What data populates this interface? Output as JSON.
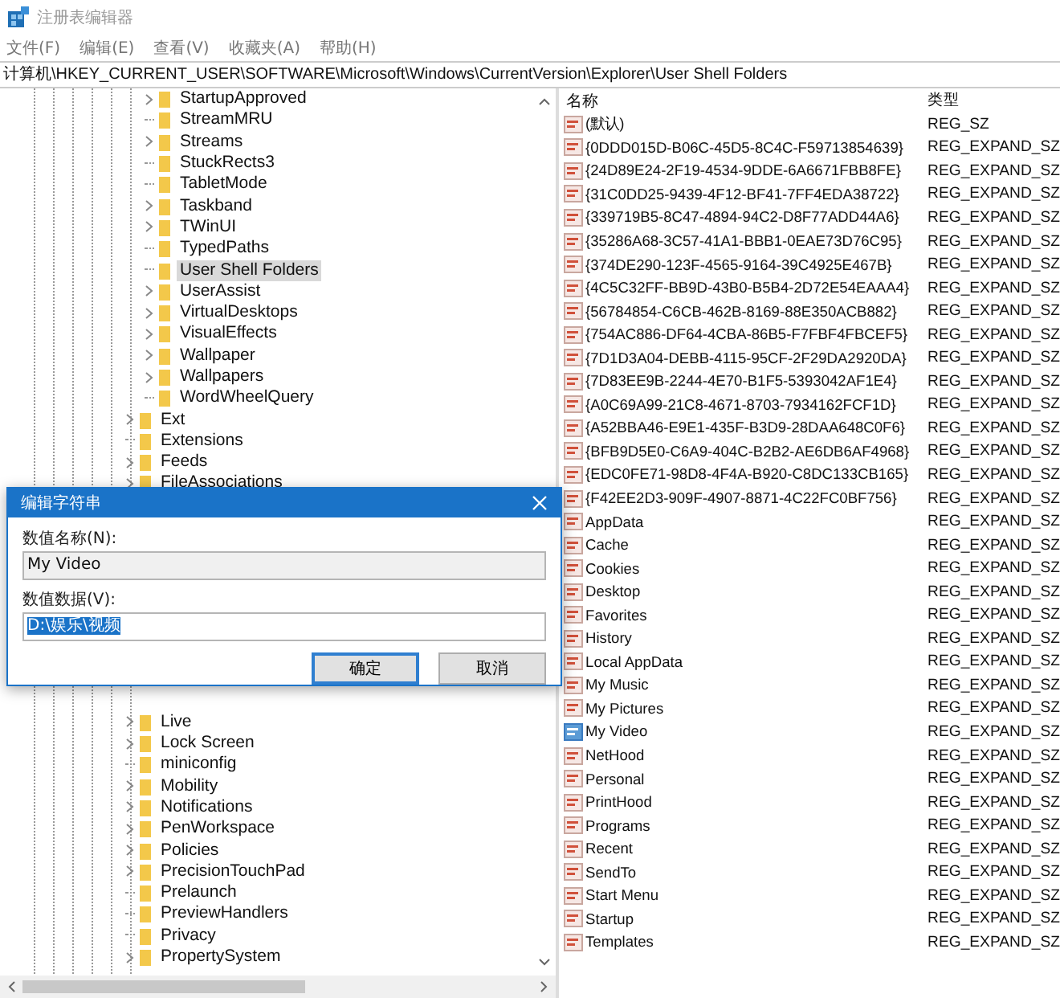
{
  "window": {
    "title": "注册表编辑器"
  },
  "menu": [
    "文件(F)",
    "编辑(E)",
    "查看(V)",
    "收藏夹(A)",
    "帮助(H)"
  ],
  "address": "计算机\\HKEY_CURRENT_USER\\SOFTWARE\\Microsoft\\Windows\\CurrentVersion\\Explorer\\User Shell Folders",
  "tree_top": [
    {
      "children": [
        {
          "label": "StartupApproved",
          "expandable": true,
          "selected": false
        },
        {
          "label": "StreamMRU",
          "expandable": false,
          "selected": false
        },
        {
          "label": "Streams",
          "expandable": true,
          "selected": false
        },
        {
          "label": "StuckRects3",
          "expandable": false,
          "selected": false
        },
        {
          "label": "TabletMode",
          "expandable": false,
          "selected": false
        },
        {
          "label": "Taskband",
          "expandable": true,
          "selected": false
        },
        {
          "label": "TWinUI",
          "expandable": true,
          "selected": false
        },
        {
          "label": "TypedPaths",
          "expandable": false,
          "selected": false
        },
        {
          "label": "User Shell Folders",
          "expandable": false,
          "selected": true
        },
        {
          "label": "UserAssist",
          "expandable": true,
          "selected": false
        },
        {
          "label": "VirtualDesktops",
          "expandable": true,
          "selected": false
        },
        {
          "label": "VisualEffects",
          "expandable": true,
          "selected": false
        },
        {
          "label": "Wallpaper",
          "expandable": true,
          "selected": false
        },
        {
          "label": "Wallpapers",
          "expandable": true,
          "selected": false
        },
        {
          "label": "WordWheelQuery",
          "expandable": false,
          "selected": false
        }
      ]
    },
    {
      "label": "Ext",
      "expandable": true,
      "selected": false
    },
    {
      "label": "Extensions",
      "expandable": false,
      "selected": false
    },
    {
      "label": "Feeds",
      "expandable": true,
      "selected": false
    },
    {
      "label": "FileAssociations",
      "expandable": true,
      "selected": false
    }
  ],
  "tree_bottom": [
    {
      "label": "Live",
      "expandable": true,
      "selected": false
    },
    {
      "label": "Lock Screen",
      "expandable": true,
      "selected": false
    },
    {
      "label": "miniconfig",
      "expandable": false,
      "selected": false
    },
    {
      "label": "Mobility",
      "expandable": true,
      "selected": false
    },
    {
      "label": "Notifications",
      "expandable": true,
      "selected": false
    },
    {
      "label": "PenWorkspace",
      "expandable": true,
      "selected": false
    },
    {
      "label": "Policies",
      "expandable": true,
      "selected": false
    },
    {
      "label": "PrecisionTouchPad",
      "expandable": true,
      "selected": false
    },
    {
      "label": "Prelaunch",
      "expandable": false,
      "selected": false
    },
    {
      "label": "PreviewHandlers",
      "expandable": false,
      "selected": false
    },
    {
      "label": "Privacy",
      "expandable": false,
      "selected": false
    },
    {
      "label": "PropertySystem",
      "expandable": true,
      "selected": false
    }
  ],
  "table": {
    "columns": [
      "名称",
      "类型"
    ],
    "rows": [
      {
        "name": "(默认)",
        "type": "REG_SZ",
        "selected": false
      },
      {
        "name": "{0DDD015D-B06C-45D5-8C4C-F59713854639}",
        "type": "REG_EXPAND_SZ",
        "selected": false
      },
      {
        "name": "{24D89E24-2F19-4534-9DDE-6A6671FBB8FE}",
        "type": "REG_EXPAND_SZ",
        "selected": false
      },
      {
        "name": "{31C0DD25-9439-4F12-BF41-7FF4EDA38722}",
        "type": "REG_EXPAND_SZ",
        "selected": false
      },
      {
        "name": "{339719B5-8C47-4894-94C2-D8F77ADD44A6}",
        "type": "REG_EXPAND_SZ",
        "selected": false
      },
      {
        "name": "{35286A68-3C57-41A1-BBB1-0EAE73D76C95}",
        "type": "REG_EXPAND_SZ",
        "selected": false
      },
      {
        "name": "{374DE290-123F-4565-9164-39C4925E467B}",
        "type": "REG_EXPAND_SZ",
        "selected": false
      },
      {
        "name": "{4C5C32FF-BB9D-43B0-B5B4-2D72E54EAAA4}",
        "type": "REG_EXPAND_SZ",
        "selected": false
      },
      {
        "name": "{56784854-C6CB-462B-8169-88E350ACB882}",
        "type": "REG_EXPAND_SZ",
        "selected": false
      },
      {
        "name": "{754AC886-DF64-4CBA-86B5-F7FBF4FBCEF5}",
        "type": "REG_EXPAND_SZ",
        "selected": false
      },
      {
        "name": "{7D1D3A04-DEBB-4115-95CF-2F29DA2920DA}",
        "type": "REG_EXPAND_SZ",
        "selected": false
      },
      {
        "name": "{7D83EE9B-2244-4E70-B1F5-5393042AF1E4}",
        "type": "REG_EXPAND_SZ",
        "selected": false
      },
      {
        "name": "{A0C69A99-21C8-4671-8703-7934162FCF1D}",
        "type": "REG_EXPAND_SZ",
        "selected": false
      },
      {
        "name": "{A52BBA46-E9E1-435F-B3D9-28DAA648C0F6}",
        "type": "REG_EXPAND_SZ",
        "selected": false
      },
      {
        "name": "{BFB9D5E0-C6A9-404C-B2B2-AE6DB6AF4968}",
        "type": "REG_EXPAND_SZ",
        "selected": false
      },
      {
        "name": "{EDC0FE71-98D8-4F4A-B920-C8DC133CB165}",
        "type": "REG_EXPAND_SZ",
        "selected": false
      },
      {
        "name": "{F42EE2D3-909F-4907-8871-4C22FC0BF756}",
        "type": "REG_EXPAND_SZ",
        "selected": false
      },
      {
        "name": "AppData",
        "type": "REG_EXPAND_SZ",
        "selected": false
      },
      {
        "name": "Cache",
        "type": "REG_EXPAND_SZ",
        "selected": false
      },
      {
        "name": "Cookies",
        "type": "REG_EXPAND_SZ",
        "selected": false
      },
      {
        "name": "Desktop",
        "type": "REG_EXPAND_SZ",
        "selected": false
      },
      {
        "name": "Favorites",
        "type": "REG_EXPAND_SZ",
        "selected": false
      },
      {
        "name": "History",
        "type": "REG_EXPAND_SZ",
        "selected": false
      },
      {
        "name": "Local AppData",
        "type": "REG_EXPAND_SZ",
        "selected": false
      },
      {
        "name": "My Music",
        "type": "REG_EXPAND_SZ",
        "selected": false
      },
      {
        "name": "My Pictures",
        "type": "REG_EXPAND_SZ",
        "selected": false
      },
      {
        "name": "My Video",
        "type": "REG_EXPAND_SZ",
        "selected": true
      },
      {
        "name": "NetHood",
        "type": "REG_EXPAND_SZ",
        "selected": false
      },
      {
        "name": "Personal",
        "type": "REG_EXPAND_SZ",
        "selected": false
      },
      {
        "name": "PrintHood",
        "type": "REG_EXPAND_SZ",
        "selected": false
      },
      {
        "name": "Programs",
        "type": "REG_EXPAND_SZ",
        "selected": false
      },
      {
        "name": "Recent",
        "type": "REG_EXPAND_SZ",
        "selected": false
      },
      {
        "name": "SendTo",
        "type": "REG_EXPAND_SZ",
        "selected": false
      },
      {
        "name": "Start Menu",
        "type": "REG_EXPAND_SZ",
        "selected": false
      },
      {
        "name": "Startup",
        "type": "REG_EXPAND_SZ",
        "selected": false
      },
      {
        "name": "Templates",
        "type": "REG_EXPAND_SZ",
        "selected": false
      }
    ]
  },
  "dialog": {
    "title": "编辑字符串",
    "name_label": "数值名称(N):",
    "name_value": "My Video",
    "data_label": "数值数据(V):",
    "data_value": "D:\\娱乐\\视频",
    "buttons": [
      {
        "label": "确定",
        "default": true
      },
      {
        "label": "取消",
        "default": false
      }
    ]
  }
}
